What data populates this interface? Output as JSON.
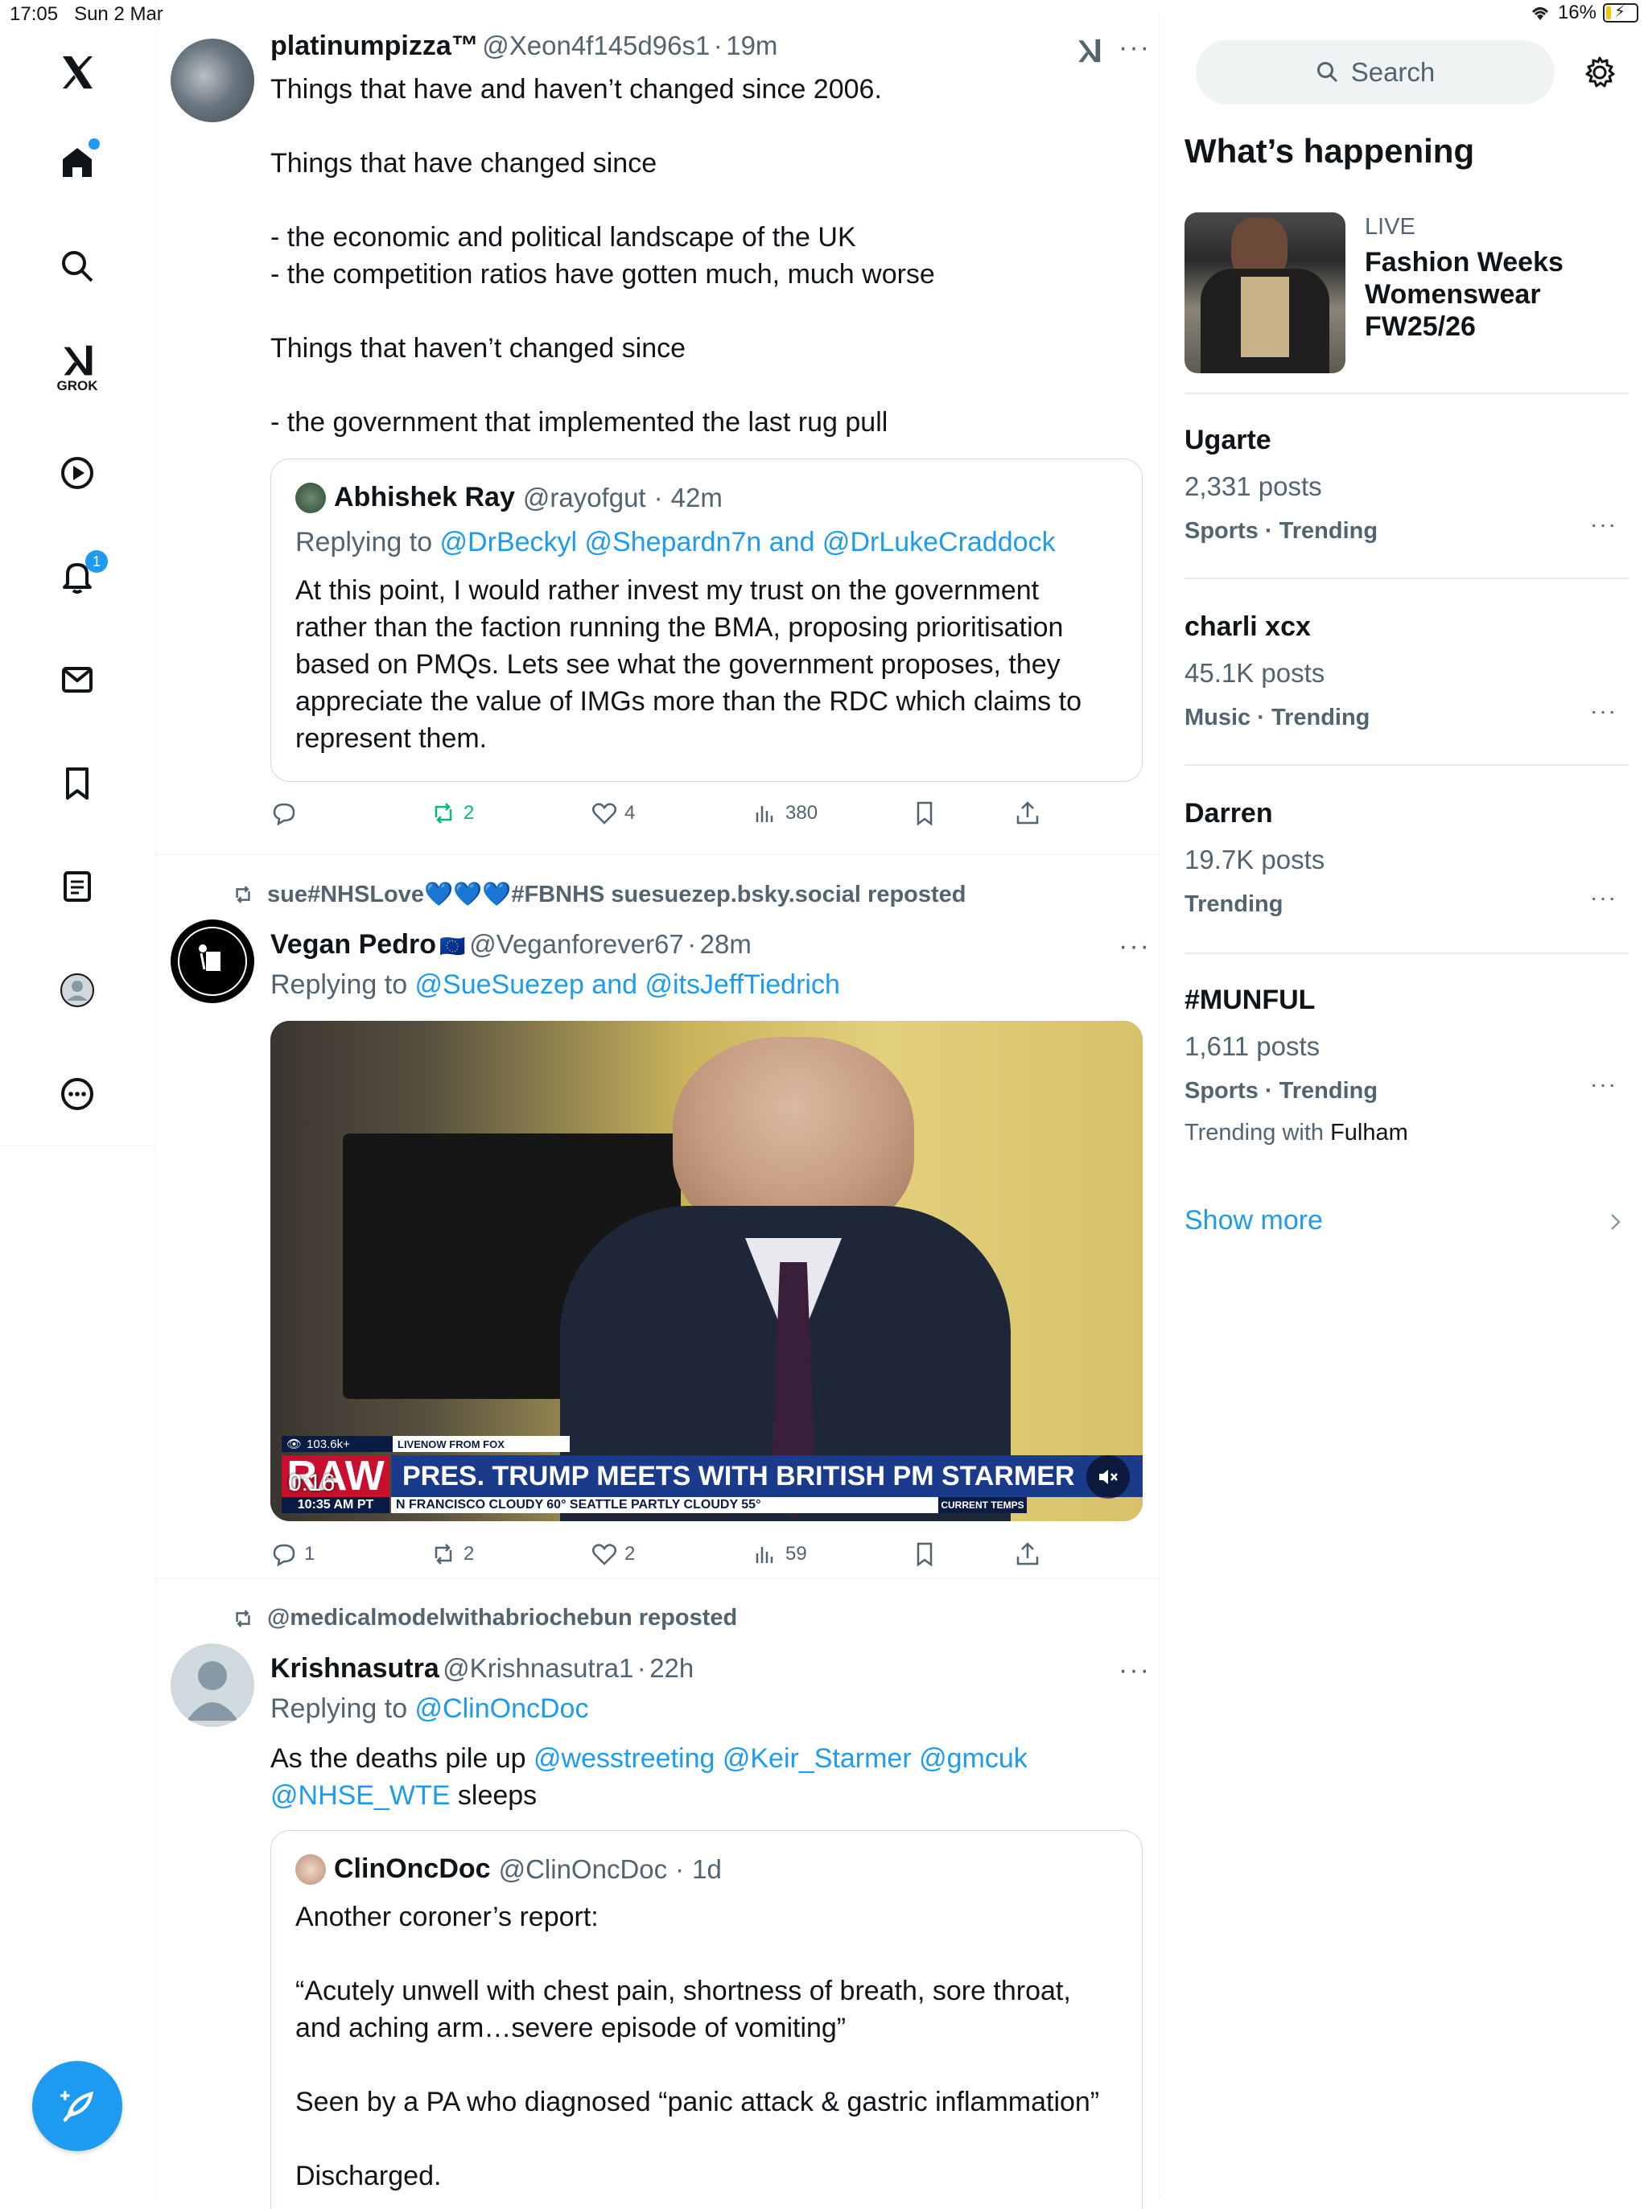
{
  "status_bar": {
    "time": "17:05",
    "date": "Sun 2 Mar",
    "battery": "16%"
  },
  "nav": {
    "items": [
      "x-logo",
      "home",
      "search",
      "grok",
      "video",
      "notifications",
      "messages",
      "bookmarks",
      "lists",
      "profile",
      "more"
    ],
    "grok_label": "GROK",
    "notifications_badge": "1"
  },
  "colors": {
    "accent": "#1d9bf0",
    "repost_green": "#00ba7c",
    "text": "#0f1419",
    "muted": "#536471"
  },
  "tweets": [
    {
      "name": "platinumpizza™",
      "handle": "@Xeon4f145d96s1",
      "time": "19m",
      "text": "Things that have and haven’t changed since 2006.\n\nThings that have changed since\n\n- the economic and political landscape of the UK\n- the competition ratios have gotten much, much worse\n\nThings that haven’t changed since\n\n- the government that implemented the last rug pull",
      "quote": {
        "name": "Abhishek Ray",
        "handle": "@rayofgut",
        "time": "42m",
        "replying_prefix": "Replying to ",
        "replying_to": "@DrBeckyl @Shepardn7n and @DrLukeCraddock",
        "text": "At this point, I would rather invest my trust on the government rather than the faction running the BMA, proposing prioritisation based on PMQs. Lets see what the government proposes, they appreciate the value of IMGs more than the RDC which claims to represent them."
      },
      "stats": {
        "replies": "",
        "reposts": "2",
        "likes": "4",
        "views": "380"
      }
    },
    {
      "repost_by": "sue#NHSLove💙💙💙#FBNHS suesuezep.bsky.social reposted",
      "name": "Vegan Pedro",
      "flag": "🇪🇺",
      "handle": "@Veganforever67",
      "time": "28m",
      "replying_prefix": "Replying to ",
      "replying_to": "@SueSuezep and @itsJeffTiedrich",
      "video": {
        "views": "103.6k+",
        "source": "LIVENOW FROM FOX",
        "brand": "RAW",
        "headline": "PRES. TRUMP MEETS WITH BRITISH PM STARMER",
        "time": "10:35 AM PT",
        "ticker": "N FRANCISCO   CLOUDY 60°   SEATTLE   PARTLY CLOUDY 55°",
        "ticker_tag": "CURRENT TEMPS",
        "duration": "0:16"
      },
      "stats": {
        "replies": "1",
        "reposts": "2",
        "likes": "2",
        "views": "59"
      }
    },
    {
      "repost_by": "@medicalmodelwithabriochebun reposted",
      "name": "Krishnasutra",
      "handle": "@Krishnasutra1",
      "time": "22h",
      "replying_prefix": "Replying to ",
      "replying_to": "@ClinOncDoc",
      "text_prefix": "As the deaths pile up ",
      "text_mentions": "@wesstreeting @Keir_Starmer @gmcuk @NHSE_WTE",
      "text_suffix": " sleeps",
      "quote": {
        "name": "ClinOncDoc",
        "handle": "@ClinOncDoc",
        "time": "1d",
        "text": "Another coroner’s report:\n\n“Acutely unwell with chest pain, shortness of breath, sore throat, and aching arm…severe episode of vomiting”\n\nSeen by a PA who diagnosed “panic attack & gastric inflammation”\n\nDischarged."
      }
    }
  ],
  "right": {
    "search_placeholder": "Search",
    "heading": "What’s happening",
    "live": {
      "label": "LIVE",
      "title": "Fashion Weeks Womenswear FW25/26"
    },
    "trends": [
      {
        "title": "Ugarte",
        "posts": "2,331 posts",
        "category": "Sports · Trending"
      },
      {
        "title": "charli xcx",
        "posts": "45.1K posts",
        "category": "Music · Trending"
      },
      {
        "title": "Darren",
        "posts": "19.7K posts",
        "category": "Trending"
      },
      {
        "title": "#MUNFUL",
        "posts": "1,611 posts",
        "category": "Sports · Trending",
        "extra_prefix": "Trending with ",
        "extra_name": "Fulham"
      }
    ],
    "show_more": "Show more"
  }
}
